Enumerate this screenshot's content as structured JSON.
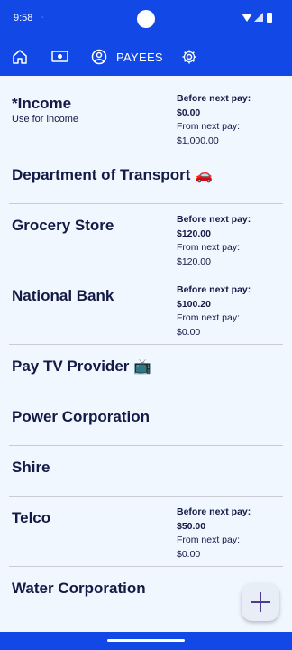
{
  "status_bar": {
    "time": "9:58",
    "indicator": "·"
  },
  "nav": {
    "icons": [
      "home-icon",
      "money-icon",
      "person-circle-icon",
      "gear-icon"
    ],
    "active_tab_label": "PAYEES"
  },
  "labels": {
    "before_next_pay": "Before next pay:",
    "from_next_pay": "From next pay:"
  },
  "payees": [
    {
      "name": "*Income",
      "subtitle": "Use for income",
      "before": "$0.00",
      "from": "$1,000.00"
    },
    {
      "name": "Department of Transport",
      "emoji": "🚗"
    },
    {
      "name": "Grocery Store",
      "before": "$120.00",
      "from": "$120.00"
    },
    {
      "name": "National Bank",
      "before": "$100.20",
      "from": "$0.00"
    },
    {
      "name": "Pay TV Provider",
      "emoji": "📺"
    },
    {
      "name": "Power Corporation"
    },
    {
      "name": "Shire"
    },
    {
      "name": "Telco",
      "before": "$50.00",
      "from": "$0.00"
    },
    {
      "name": "Water Corporation"
    }
  ],
  "fab": {
    "icon": "plus-icon"
  },
  "colors": {
    "primary": "#1248e6",
    "background": "#f1f7ff",
    "text": "#131a45",
    "fab_icon": "#4c3d8c"
  }
}
